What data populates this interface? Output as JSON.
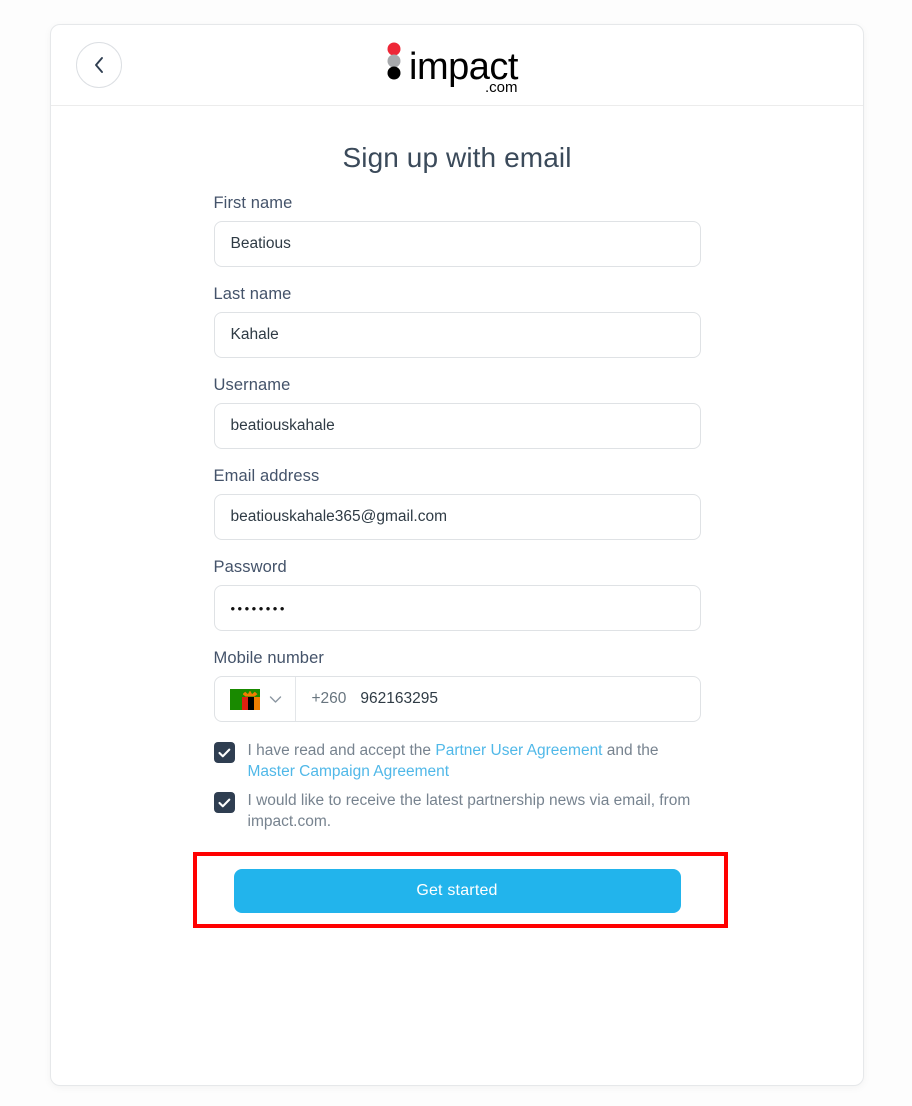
{
  "header": {
    "back_icon": "chevron-left-icon",
    "logo": {
      "wordmark": "impact",
      "suffix": ".com",
      "dot_colors": [
        "#ee2737",
        "#a7a9ac",
        "#000000"
      ]
    }
  },
  "main": {
    "title": "Sign up with email",
    "fields": [
      {
        "id": "first-name",
        "label": "First name",
        "value": "Beatious",
        "placeholder": ""
      },
      {
        "id": "last-name",
        "label": "Last name",
        "value": "Kahale",
        "placeholder": ""
      },
      {
        "id": "username",
        "label": "Username",
        "value": "beatiouskahale",
        "placeholder": ""
      },
      {
        "id": "email-address",
        "label": "Email address",
        "value": "beatiouskahale365@gmail.com",
        "placeholder": ""
      },
      {
        "id": "password",
        "label": "Password",
        "value": "••••••••",
        "placeholder": ""
      }
    ],
    "mobile": {
      "label": "Mobile number",
      "country_flag": "zambia-flag-icon",
      "country_dropdown_icon": "chevron-down-icon",
      "dial_code": "+260",
      "number": "962163295",
      "placeholder": ""
    },
    "consents": [
      {
        "id": "terms",
        "checked": true,
        "text_before": "I have read and accept the ",
        "link1": "Partner User Agreement",
        "text_middle": " and the ",
        "link2": "Master Campaign Agreement",
        "text_after": ""
      },
      {
        "id": "newsletter",
        "checked": true,
        "text_before": "I would like to receive the latest partnership news via email, from impact.com.",
        "link1": "",
        "text_middle": "",
        "link2": "",
        "text_after": ""
      }
    ],
    "submit_label": "Get started"
  },
  "colors": {
    "primary_button": "#22b4ec",
    "link": "#50b8e8",
    "checkbox": "#2f3e51",
    "label": "#44536a",
    "annotation": "#ff0000"
  }
}
